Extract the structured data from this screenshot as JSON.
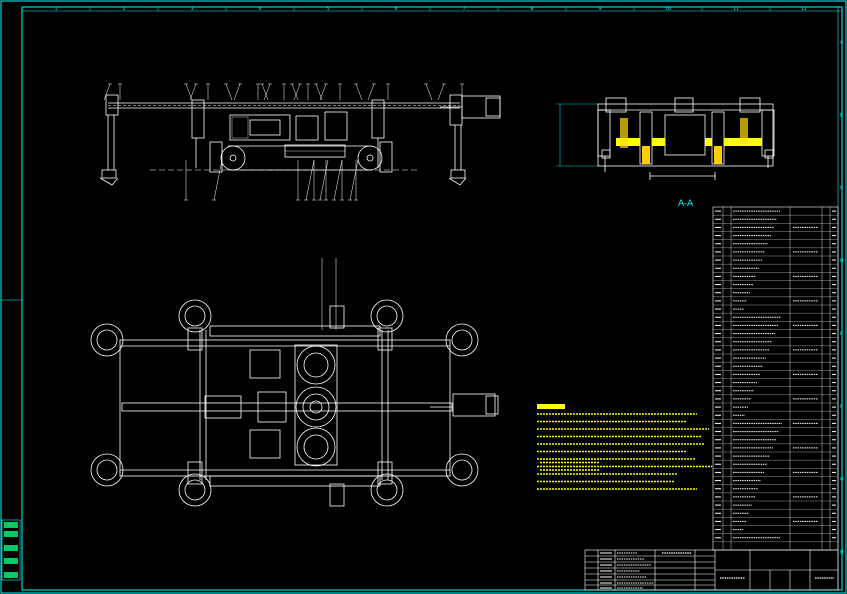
{
  "drawing": {
    "section_label": "A-A",
    "colors": {
      "background": "#000000",
      "frame": "#00ffff",
      "geometry": "#ffffff",
      "notes": "#ffff00",
      "hatch": "#ffff00",
      "table_lines": "#ffffff"
    },
    "column_ticks": [
      "1",
      "2",
      "3",
      "4",
      "5",
      "6",
      "7",
      "8",
      "9",
      "10",
      "11",
      "12"
    ],
    "row_ticks": [
      "A",
      "B",
      "C",
      "D",
      "E",
      "F",
      "G",
      "H"
    ],
    "tech_note_lines": 11,
    "bom_rows": 42,
    "side_strip_labels": 5
  }
}
